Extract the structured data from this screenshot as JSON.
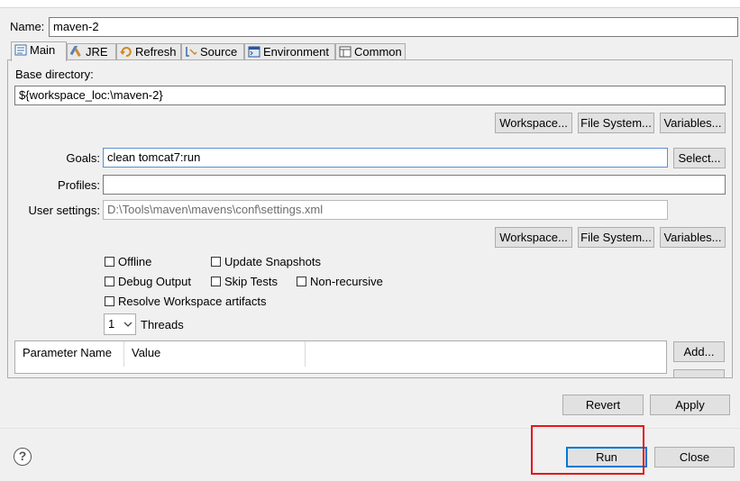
{
  "name": {
    "label": "Name:",
    "value": "maven-2"
  },
  "tabs": [
    {
      "label": "Main",
      "icon": "main-tab-icon"
    },
    {
      "label": "JRE",
      "icon": "jre-icon"
    },
    {
      "label": "Refresh",
      "icon": "refresh-icon"
    },
    {
      "label": "Source",
      "icon": "source-icon"
    },
    {
      "label": "Environment",
      "icon": "environment-icon"
    },
    {
      "label": "Common",
      "icon": "common-icon"
    }
  ],
  "main": {
    "base_directory": {
      "label": "Base directory:",
      "value": "${workspace_loc:\\maven-2}"
    },
    "base_buttons": {
      "workspace": "Workspace...",
      "file_system": "File System...",
      "variables": "Variables..."
    },
    "goals": {
      "label": "Goals:",
      "value": "clean tomcat7:run",
      "select": "Select..."
    },
    "profiles": {
      "label": "Profiles:",
      "value": ""
    },
    "user_settings": {
      "label": "User settings:",
      "value": "D:\\Tools\\maven\\mavens\\conf\\settings.xml"
    },
    "settings_buttons": {
      "workspace": "Workspace...",
      "file_system": "File System...",
      "variables": "Variables..."
    },
    "options": {
      "offline": "Offline",
      "update_snapshots": "Update Snapshots",
      "debug_output": "Debug Output",
      "skip_tests": "Skip Tests",
      "non_recursive": "Non-recursive",
      "resolve_workspace": "Resolve Workspace artifacts"
    },
    "threads": {
      "value": "1",
      "label": "Threads"
    },
    "params_table": {
      "col_name": "Parameter Name",
      "col_value": "Value",
      "add": "Add..."
    }
  },
  "footer": {
    "revert": "Revert",
    "apply": "Apply",
    "help": "?",
    "run": "Run",
    "close": "Close"
  },
  "colors": {
    "highlight": "#e0161b",
    "focus": "#0078d7"
  }
}
